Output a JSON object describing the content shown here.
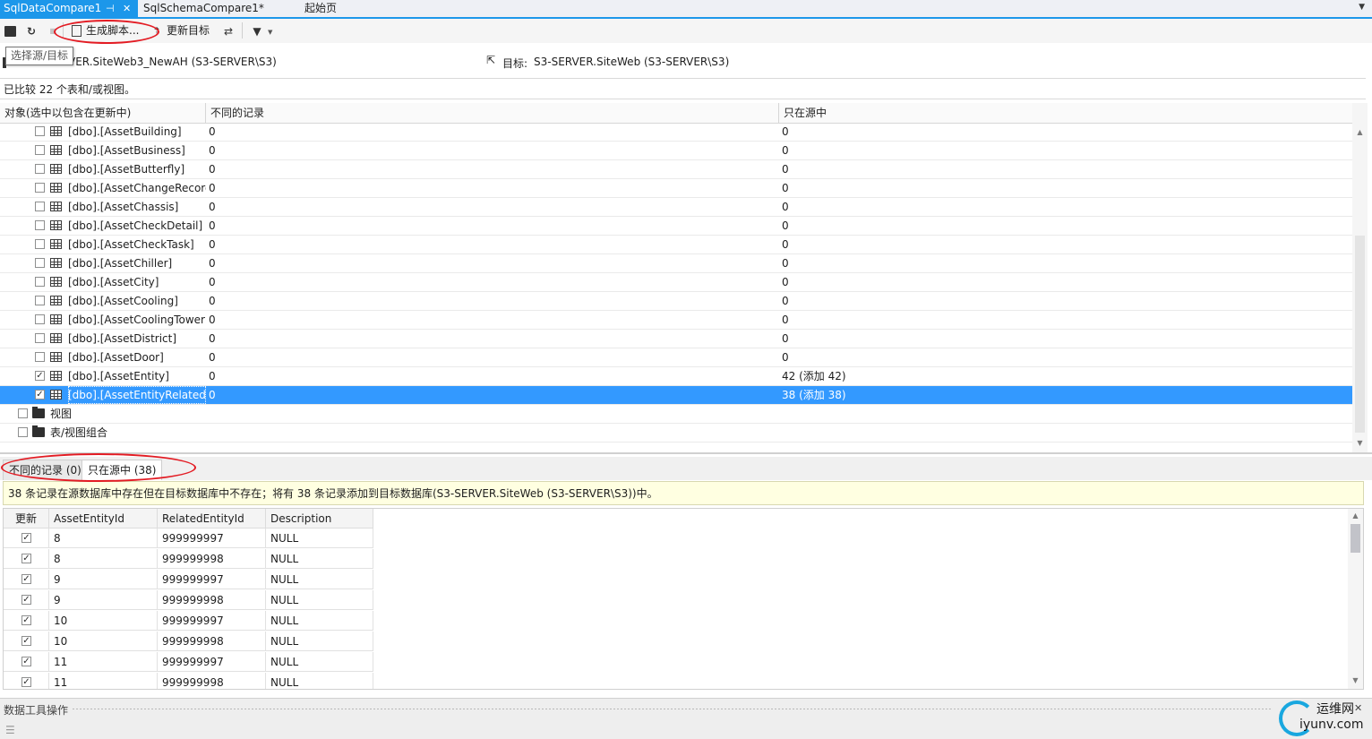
{
  "tabs": [
    {
      "label": "SqlDataCompare1",
      "active": true,
      "pin": "⊣",
      "close": "✕"
    },
    {
      "label": "SqlSchemaCompare1*",
      "active": false
    },
    {
      "label": "起始页",
      "active": false
    }
  ],
  "toolbar": {
    "generate_script": "生成脚本...",
    "update_target": "更新目标",
    "tooltip": "选择源/目标"
  },
  "source_target": {
    "source": "VER.SiteWeb3_NewAH (S3-SERVER\\S3)",
    "target_label": "目标:",
    "target": "S3-SERVER.SiteWeb (S3-SERVER\\S3)"
  },
  "summary": "已比较 22 个表和/或视图。",
  "object_grid": {
    "headers": [
      "对象(选中以包含在更新中)",
      "不同的记录",
      "只在源中"
    ],
    "rows": [
      {
        "name": "[dbo].[AssetBuilding]",
        "diff": "0",
        "only_src": "0",
        "checked": false
      },
      {
        "name": "[dbo].[AssetBusiness]",
        "diff": "0",
        "only_src": "0",
        "checked": false
      },
      {
        "name": "[dbo].[AssetButterfly]",
        "diff": "0",
        "only_src": "0",
        "checked": false
      },
      {
        "name": "[dbo].[AssetChangeRecord",
        "diff": "0",
        "only_src": "0",
        "checked": false
      },
      {
        "name": "[dbo].[AssetChassis]",
        "diff": "0",
        "only_src": "0",
        "checked": false
      },
      {
        "name": "[dbo].[AssetCheckDetail]",
        "diff": "0",
        "only_src": "0",
        "checked": false
      },
      {
        "name": "[dbo].[AssetCheckTask]",
        "diff": "0",
        "only_src": "0",
        "checked": false
      },
      {
        "name": "[dbo].[AssetChiller]",
        "diff": "0",
        "only_src": "0",
        "checked": false
      },
      {
        "name": "[dbo].[AssetCity]",
        "diff": "0",
        "only_src": "0",
        "checked": false
      },
      {
        "name": "[dbo].[AssetCooling]",
        "diff": "0",
        "only_src": "0",
        "checked": false
      },
      {
        "name": "[dbo].[AssetCoolingTower]",
        "diff": "0",
        "only_src": "0",
        "checked": false
      },
      {
        "name": "[dbo].[AssetDistrict]",
        "diff": "0",
        "only_src": "0",
        "checked": false
      },
      {
        "name": "[dbo].[AssetDoor]",
        "diff": "0",
        "only_src": "0",
        "checked": false
      },
      {
        "name": "[dbo].[AssetEntity]",
        "diff": "0",
        "only_src": "42 (添加 42)",
        "checked": true
      },
      {
        "name": "[dbo].[AssetEntityRelatedT",
        "diff": "0",
        "only_src": "38 (添加 38)",
        "checked": true,
        "selected": true
      }
    ],
    "groups": [
      {
        "label": "视图"
      },
      {
        "label": "表/视图组合"
      }
    ]
  },
  "lower_tabs": {
    "diff_records": "不同的记录 (0)",
    "only_in_source": "只在源中 (38)"
  },
  "info_message": "38 条记录在源数据库中存在但在目标数据库中不存在；将有 38 条记录添加到目标数据库(S3-SERVER.SiteWeb (S3-SERVER\\S3))中。",
  "record_grid": {
    "headers": [
      "更新",
      "AssetEntityId",
      "RelatedEntityId",
      "Description"
    ],
    "rows": [
      {
        "id": "8",
        "related": "999999997",
        "desc": "NULL"
      },
      {
        "id": "8",
        "related": "999999998",
        "desc": "NULL"
      },
      {
        "id": "9",
        "related": "999999997",
        "desc": "NULL"
      },
      {
        "id": "9",
        "related": "999999998",
        "desc": "NULL"
      },
      {
        "id": "10",
        "related": "999999997",
        "desc": "NULL"
      },
      {
        "id": "10",
        "related": "999999998",
        "desc": "NULL"
      },
      {
        "id": "11",
        "related": "999999997",
        "desc": "NULL"
      },
      {
        "id": "11",
        "related": "999999998",
        "desc": "NULL"
      }
    ]
  },
  "statusbar": {
    "label": "数据工具操作",
    "watermark_brand": "运维网",
    "watermark_url": "iyunv.com",
    "close": "✕"
  },
  "colors": {
    "accent": "#1c97ea",
    "selection": "#3399ff",
    "annotation": "#e31b23",
    "info_bg": "#ffffe1"
  }
}
